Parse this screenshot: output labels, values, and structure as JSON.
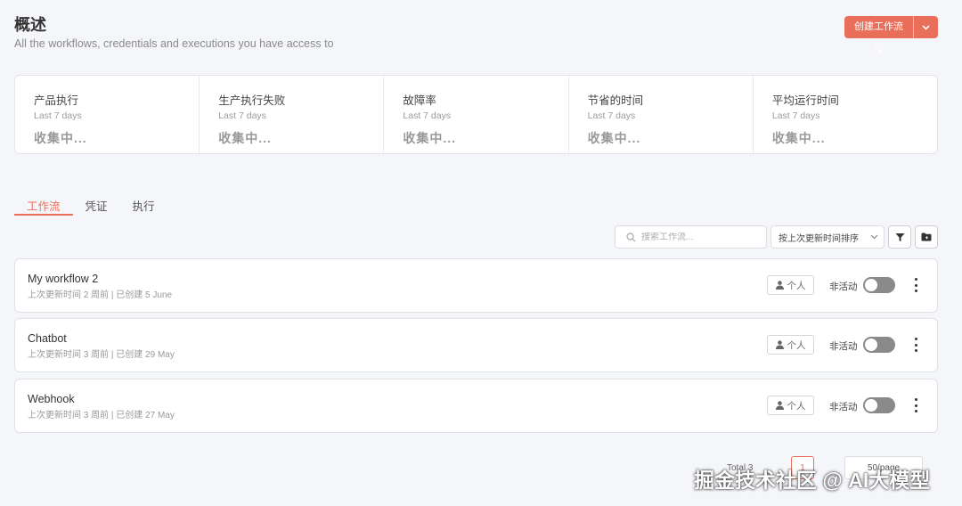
{
  "header": {
    "title": "概述",
    "subtitle": "All the workflows, credentials and executions you have access to",
    "create_label": "创建工作流程"
  },
  "stats": [
    {
      "title": "产品执行",
      "period": "Last 7 days",
      "value": "收集中..."
    },
    {
      "title": "生产执行失败",
      "period": "Last 7 days",
      "value": "收集中..."
    },
    {
      "title": "故障率",
      "period": "Last 7 days",
      "value": "收集中..."
    },
    {
      "title": "节省的时间",
      "period": "Last 7 days",
      "value": "收集中..."
    },
    {
      "title": "平均运行时间",
      "period": "Last 7 days",
      "value": "收集中..."
    }
  ],
  "tabs": [
    {
      "label": "工作流",
      "active": true
    },
    {
      "label": "凭证",
      "active": false
    },
    {
      "label": "执行",
      "active": false
    }
  ],
  "toolbar": {
    "search_placeholder": "搜索工作流...",
    "sort_label": "按上次更新时间排序"
  },
  "workflows": [
    {
      "name": "My workflow 2",
      "meta": "上次更新时间 2 周前 | 已创建 5 June",
      "owner": "个人",
      "status": "非活动",
      "active": false
    },
    {
      "name": "Chatbot",
      "meta": "上次更新时间 3 周前 | 已创建 29 May",
      "owner": "个人",
      "status": "非活动",
      "active": false
    },
    {
      "name": "Webhook",
      "meta": "上次更新时间 3 周前 | 已创建 27 May",
      "owner": "个人",
      "status": "非活动",
      "active": false
    }
  ],
  "pagination": {
    "total": "Total 3",
    "page": "1",
    "page_size": "50/page"
  },
  "watermark": "掘金技术社区 @ AI大模型",
  "colors": {
    "accent": "#ea6f5a",
    "background": "#f5f6fa",
    "toggle_off": "#8a8a8a"
  }
}
